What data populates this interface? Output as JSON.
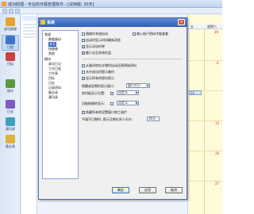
{
  "app": {
    "title": "成功助理 - 专业的日程管理软件 - [试用版: 30天]"
  },
  "sidebar": {
    "items": [
      {
        "label": "成功助理",
        "icon": "star-icon",
        "color": "#e8a136"
      },
      {
        "label": "日程",
        "icon": "calendar-icon",
        "color": "#3f73c9"
      },
      {
        "label": "目标",
        "icon": "target-icon",
        "color": "#c9433f"
      },
      {
        "label": "统计",
        "icon": "chart-icon",
        "color": "#5b9a3f"
      },
      {
        "label": "日志",
        "icon": "journal-icon",
        "color": "#7a5bc2"
      },
      {
        "label": "通讯录",
        "icon": "contacts-icon",
        "color": "#3e9fb8"
      },
      {
        "label": "备忘录",
        "icon": "memo-icon",
        "color": "#e1b13a"
      }
    ]
  },
  "calendar": {
    "headers": [
      "五",
      "星期六"
    ],
    "dates": [
      "29",
      "6",
      "13",
      "20",
      "27"
    ],
    "today_label": "12"
  },
  "dialog": {
    "title": "系统",
    "close_label": "×",
    "tree": [
      {
        "label": "常规",
        "level": 0,
        "selected": false
      },
      {
        "label": "数据备份",
        "level": 1,
        "selected": false
      },
      {
        "label": "安全",
        "level": 1,
        "selected": true
      },
      {
        "label": "快捷键",
        "level": 1,
        "selected": false
      },
      {
        "label": "其他",
        "level": 1,
        "selected": false
      },
      {
        "label": "模块",
        "level": 0,
        "selected": false
      },
      {
        "label": "成功日记",
        "level": 1,
        "selected": false
      },
      {
        "label": "工作日程",
        "level": 1,
        "selected": false
      },
      {
        "label": "工作表",
        "level": 1,
        "selected": false
      },
      {
        "label": "目标",
        "level": 1,
        "selected": false
      },
      {
        "label": "日志",
        "level": 1,
        "selected": false
      },
      {
        "label": "记录资料",
        "level": 1,
        "selected": false
      },
      {
        "label": "备忘录",
        "level": 1,
        "selected": false
      },
      {
        "label": "通讯录",
        "level": 1,
        "selected": false
      }
    ],
    "options": {
      "opt1": {
        "label": "随操作系统启动",
        "checked": false
      },
      "opt2": {
        "label": "输入帐户密码才能查看",
        "checked": false
      },
      "opt3": {
        "label": "启动时显示时间最新消息",
        "checked": true
      },
      "opt4": {
        "label": "显示浮动时钟",
        "checked": true
      },
      "opt5": {
        "label": "最小化至系统托盘",
        "checked": true
      },
      "opt6": {
        "label": "从备份地址存储时自动还原原始资料",
        "checked": false
      },
      "opt7": {
        "label": "允许退出时提示备份",
        "checked": false
      },
      "opt8": {
        "label": "显示所有的保存提示",
        "checked": true
      },
      "select1_label": "隐藏或定期时显示窗口:",
      "select1_value": "窗口大小",
      "select2_label": "剪切板显示位置:",
      "select2_value": "自定义",
      "select3_label": "功能按键的显示:",
      "select3_value": "自定义",
      "opt9": {
        "label": "隐藏所有的设置窗口和工具栏",
        "checked": true
      },
      "spin_label": "不填写日期时, 提示日期在多少天内:",
      "spin_value": "30天"
    },
    "buttons": {
      "ok": "确定",
      "apply": "应用",
      "cancel": "取消"
    }
  }
}
